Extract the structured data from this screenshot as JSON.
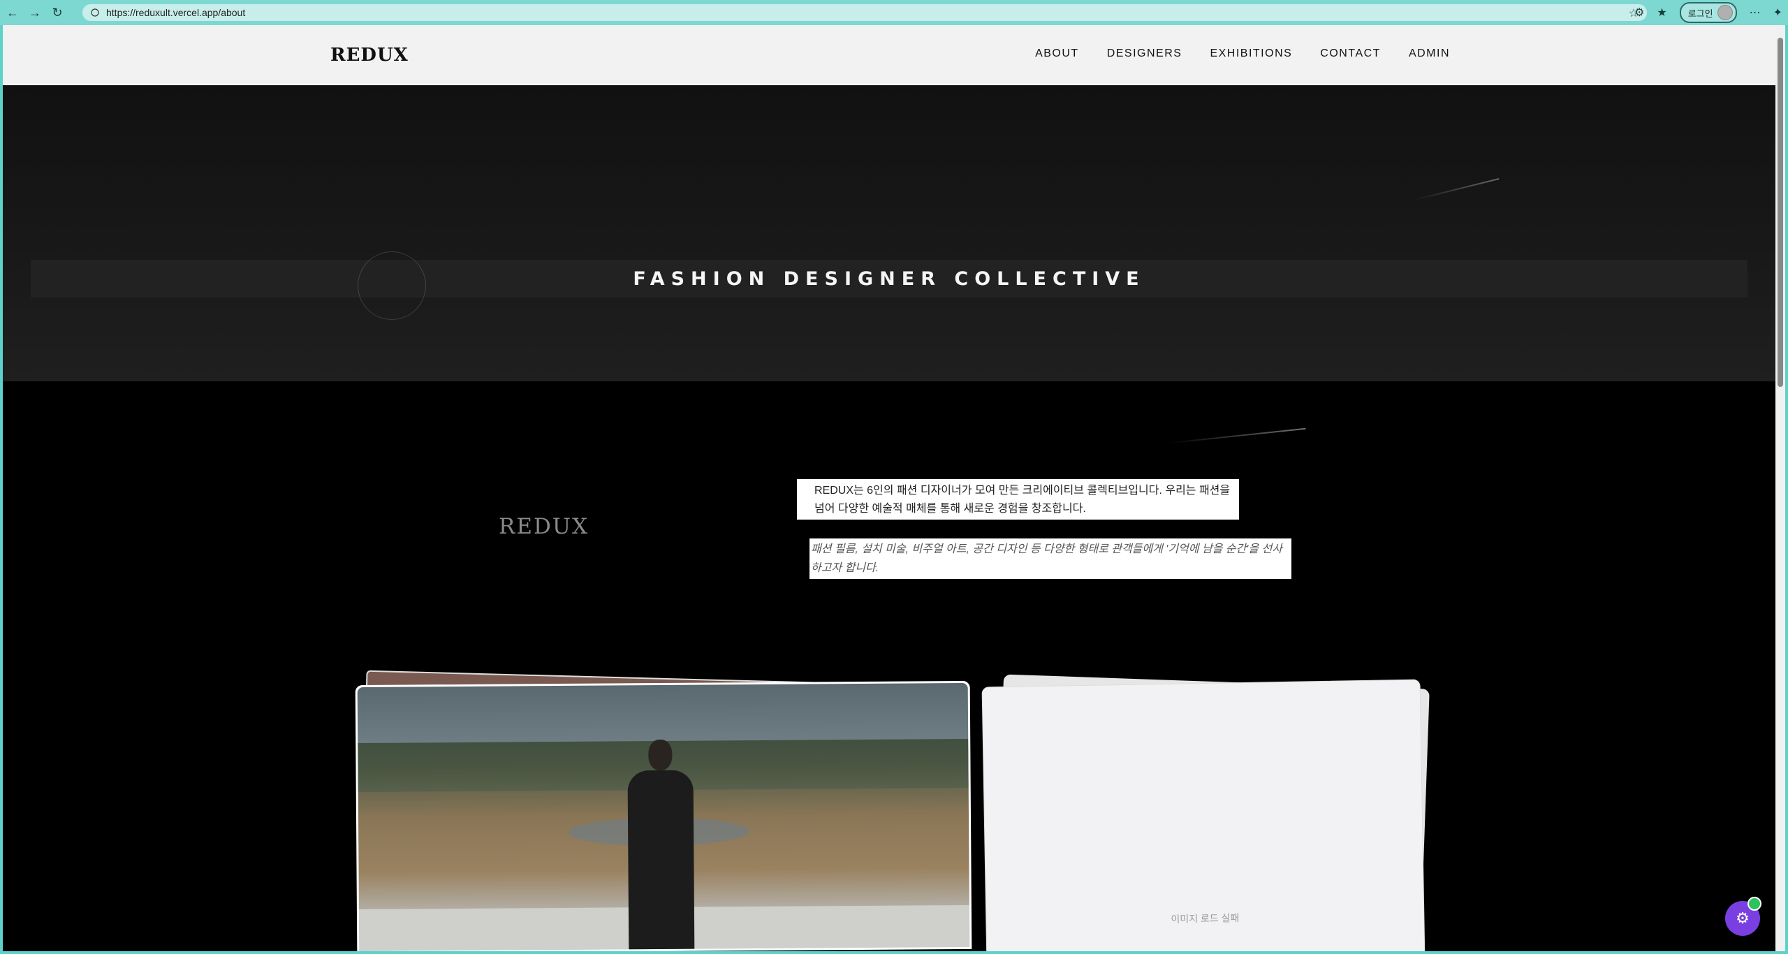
{
  "browser": {
    "url": "https://reduxult.vercel.app/about",
    "login_label": "로그인"
  },
  "site": {
    "logo": "REDUX",
    "nav": [
      "ABOUT",
      "DESIGNERS",
      "EXHIBITIONS",
      "CONTACT",
      "ADMIN"
    ]
  },
  "hero": {
    "title": "FASHION DESIGNER COLLECTIVE"
  },
  "about": {
    "logo": "REDUX",
    "text1": "REDUX는 6인의 패션 디자이너가 모여 만든 크리에이티브 콜렉티브입니다. 우리는 패션을 넘어 다양한 예술적 매체를 통해 새로운 경험을 창조합니다.",
    "text2": "패션 필름, 설치 미술, 비주얼 아트, 공간 디자인 등 다양한 형태로 관객들에게 '기억에 남을 순간'을 선사하고자 합니다."
  },
  "gallery": {
    "load_fail": "이미지 로드 실패"
  },
  "icons": {
    "back": "back-arrow-icon",
    "forward": "forward-arrow-icon",
    "reload": "reload-icon",
    "star": "star-icon",
    "gear": "gear-icon"
  },
  "colors": {
    "browser_accent": "#5fd1cb",
    "floating_button": "#7a3fe0"
  }
}
